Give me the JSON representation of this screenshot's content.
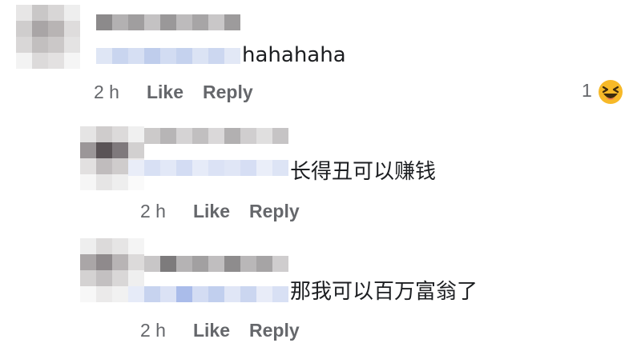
{
  "comments": [
    {
      "text": "hahahaha",
      "time": "2 h",
      "like_label": "Like",
      "reply_label": "Reply",
      "reaction_count": "1",
      "reaction_icon": "laughing-emoji"
    },
    {
      "text": "长得丑可以赚钱",
      "time": "2 h",
      "like_label": "Like",
      "reply_label": "Reply"
    },
    {
      "text": "那我可以百万富翁了",
      "time": "2 h",
      "like_label": "Like",
      "reply_label": "Reply"
    }
  ],
  "colors": {
    "meta_text": "#65676b",
    "body_text": "#1c1e21",
    "reaction_face": "#f7b928"
  }
}
